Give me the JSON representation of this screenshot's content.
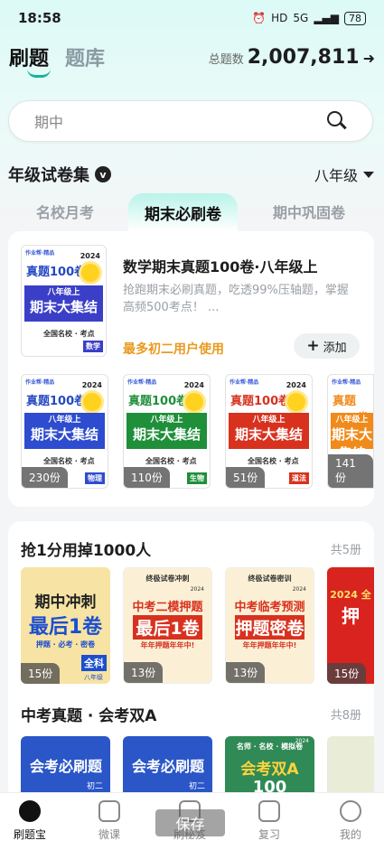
{
  "status": {
    "time": "18:58",
    "network": "HD",
    "signal": "5G",
    "battery": "78"
  },
  "header": {
    "tabs": [
      {
        "label": "刷题"
      },
      {
        "label": "题库"
      }
    ],
    "total_label": "总题数",
    "total_value": "2,007,811",
    "total_arrow": "➜"
  },
  "search": {
    "placeholder": "期中"
  },
  "collection": {
    "title": "年级试卷集",
    "badge": "v",
    "grade": "八年级",
    "sub_tabs": [
      {
        "label": "名校月考"
      },
      {
        "label": "期末必刷卷"
      },
      {
        "label": "期中巩固卷"
      }
    ],
    "featured": {
      "title": "数学期末真题100卷·八年级上",
      "desc": "抢跑期末必刷真题，吃透99%压轴题，掌握高频500考点！ ...",
      "users": "最多初二用户使用",
      "add_label": "添加",
      "add_icon": "+",
      "cover": {
        "brand": "作业帮·精品",
        "title": "真题100卷",
        "year": "2024",
        "grade": "八年级上",
        "main": "期末大集结",
        "foot": "全国名校 · 考点",
        "subject": "数学"
      }
    },
    "books": [
      {
        "subject": "物理",
        "count": "230份",
        "color": "#2e4ccf"
      },
      {
        "subject": "生物",
        "count": "110份",
        "color": "#1f8f3a"
      },
      {
        "subject": "道法",
        "count": "51份",
        "color": "#d8321f"
      },
      {
        "subject": "",
        "count": "141份",
        "color": "#f08a1a"
      }
    ]
  },
  "section2": {
    "title": "抢1分用掉1000人",
    "count_label": "共5册",
    "posters": [
      {
        "line1": "期中冲刺",
        "line2": "最后1卷",
        "tag": "押题 · 必考 · 密卷",
        "count": "15份",
        "badge": "全科",
        "badge2": "八年级"
      },
      {
        "line1": "中考二模押题",
        "line2": "最后1卷",
        "tag": "年年押题年年中!",
        "count": "13份",
        "top": "终极试卷冲刺",
        "year": "2024"
      },
      {
        "line1": "中考临考预测",
        "line2": "押题密卷",
        "tag": "年年押题年年中!",
        "count": "13份",
        "top": "终极试卷密训",
        "year": "2024"
      },
      {
        "line1": "2024 全",
        "line2": "押",
        "count": "15份"
      }
    ]
  },
  "section3": {
    "title": "中考真题 · 会考双A",
    "count_label": "共8册",
    "posters": [
      {
        "main": "会考必刷题",
        "grade": "初二"
      },
      {
        "main": "会考必刷题",
        "grade": "初二"
      },
      {
        "main": "会考双A",
        "top": "名师 · 名校 · 模拟卷",
        "year": "2024",
        "sub": "100"
      },
      {
        "main": ""
      }
    ]
  },
  "tabbar": [
    {
      "label": "刷题宝",
      "active": true,
      "icon": "search-home-icon"
    },
    {
      "label": "微课",
      "icon": "video-icon"
    },
    {
      "label": "刷秘笈",
      "icon": "book-icon"
    },
    {
      "label": "复习",
      "icon": "review-icon"
    },
    {
      "label": "我的",
      "icon": "profile-icon"
    }
  ],
  "toast": "保存"
}
